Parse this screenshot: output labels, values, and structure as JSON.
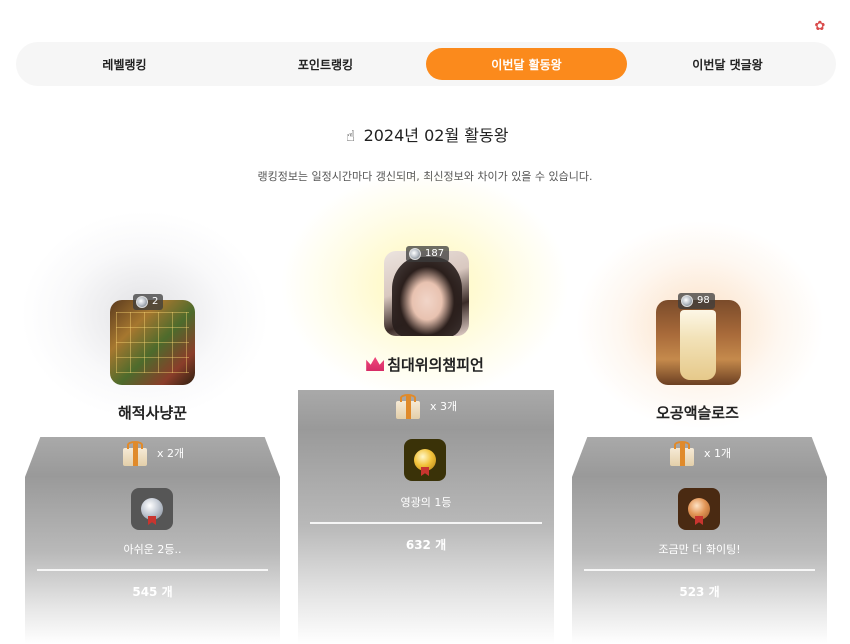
{
  "header": {
    "settings_icon": "gear-icon",
    "settings_color": "#d94b4b"
  },
  "tabs": [
    {
      "label": "레벨랭킹",
      "active": false
    },
    {
      "label": "포인트랭킹",
      "active": false
    },
    {
      "label": "이번달 활동왕",
      "active": true
    },
    {
      "label": "이번달 댓글왕",
      "active": false
    }
  ],
  "accent_color": "#fb8a1c",
  "title": {
    "icon": "pointing-hand-icon",
    "text": "2024년 02월 활동왕"
  },
  "notice": "랭킹정보는 일정시간마다 갱신되며, 최신정보와 차이가 있을 수 있습니다.",
  "ranking": {
    "second": {
      "level": "2",
      "name": "해적사냥꾼",
      "gift_count": "x 2개",
      "medal": "silver-medal-icon",
      "message": "아쉬운 2등..",
      "count": "545 개"
    },
    "first": {
      "level": "187",
      "name": "침대위의챔피언",
      "name_icon": "crown-icon",
      "gift_count": "x 3개",
      "medal": "gold-medal-icon",
      "message": "영광의 1등",
      "count": "632 개"
    },
    "third": {
      "level": "98",
      "name": "오공액슬로즈",
      "gift_count": "x 1개",
      "medal": "bronze-medal-icon",
      "message": "조금만 더 화이팅!",
      "count": "523 개"
    }
  }
}
